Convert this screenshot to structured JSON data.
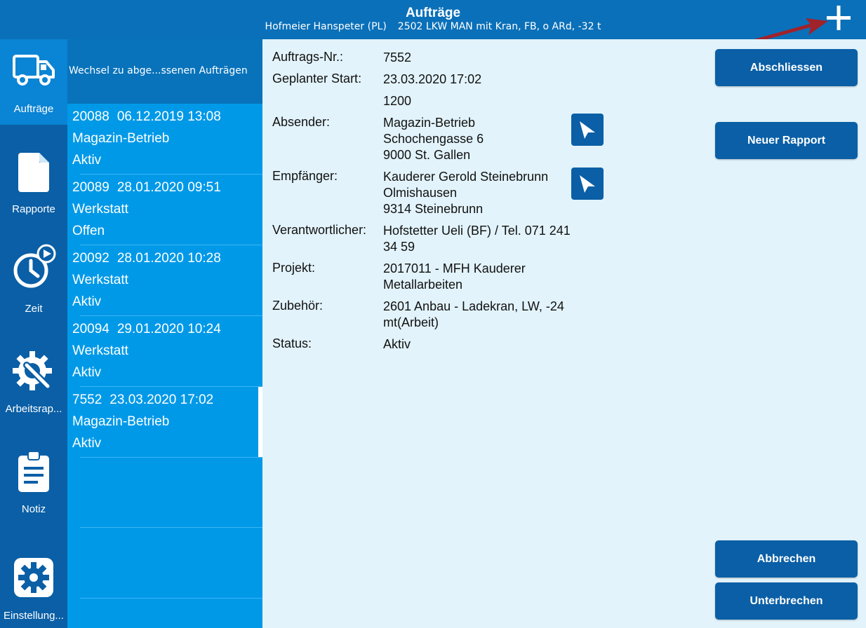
{
  "header": {
    "title": "Aufträge",
    "user": "Hofmeier Hanspeter (PL)",
    "vehicle": "2502 LKW MAN mit Kran, FB, o ARd, -32 t",
    "add_icon": "plus-icon"
  },
  "sidebar": {
    "items": [
      {
        "label": "Aufträge",
        "icon": "truck-icon",
        "active": true
      },
      {
        "label": "Rapporte",
        "icon": "document-icon"
      },
      {
        "label": "Zeit",
        "icon": "clock-play-icon"
      },
      {
        "label": "Arbeitsrap...",
        "icon": "gear-wrench-icon"
      },
      {
        "label": "Notiz",
        "icon": "clipboard-icon"
      },
      {
        "label": "Einstellung...",
        "icon": "settings-icon"
      }
    ]
  },
  "list": {
    "header": "Wechsel zu abge...ssenen Aufträgen",
    "items": [
      {
        "number": "20088",
        "date": "06.12.2019 13:08",
        "location": "Magazin-Betrieb",
        "status": "Aktiv"
      },
      {
        "number": "20089",
        "date": "28.01.2020 09:51",
        "location": "Werkstatt",
        "status": "Offen"
      },
      {
        "number": "20092",
        "date": "28.01.2020 10:28",
        "location": "Werkstatt",
        "status": "Aktiv"
      },
      {
        "number": "20094",
        "date": "29.01.2020 10:24",
        "location": "Werkstatt",
        "status": "Aktiv"
      },
      {
        "number": "7552",
        "date": "23.03.2020 17:02",
        "location": "Magazin-Betrieb",
        "status": "Aktiv",
        "selected": true
      }
    ]
  },
  "detail": {
    "auftragsnr_label": "Auftrags-Nr.:",
    "auftragsnr": "7552",
    "start_label": "Geplanter Start:",
    "start": "23.03.2020 17:02",
    "start_extra": "1200",
    "absender_label": "Absender:",
    "absender": [
      "Magazin-Betrieb",
      "Schochengasse 6",
      "9000 St. Gallen"
    ],
    "empfaenger_label": "Empfänger:",
    "empfaenger": [
      "Kauderer Gerold Steinebrunn",
      "Olmishausen",
      "9314 Steinebrunn"
    ],
    "verantwortlicher_label": "Verantwortlicher:",
    "verantwortlicher": [
      "Hofstetter Ueli (BF) / Tel. 071 241",
      "34 59"
    ],
    "projekt_label": "Projekt:",
    "projekt": [
      "2017011 - MFH Kauderer",
      "Metallarbeiten"
    ],
    "zubehoer_label": "Zubehör:",
    "zubehoer": [
      "2601 Anbau - Ladekran, LW, -24",
      "mt(Arbeit)"
    ],
    "status_label": "Status:",
    "status": "Aktiv"
  },
  "actions": {
    "abschliessen": "Abschliessen",
    "neuer_rapport": "Neuer Rapport",
    "abbrechen": "Abbrechen",
    "unterbrechen": "Unterbrechen"
  },
  "colors": {
    "header": "#0a70b9",
    "sidebar": "#0a5fa6",
    "sidebar_active": "#0a84d4",
    "list": "#0099e8",
    "detail_bg": "#e2f3fb",
    "button": "#0a5fa6",
    "annotation_arrow": "#a0222a"
  }
}
